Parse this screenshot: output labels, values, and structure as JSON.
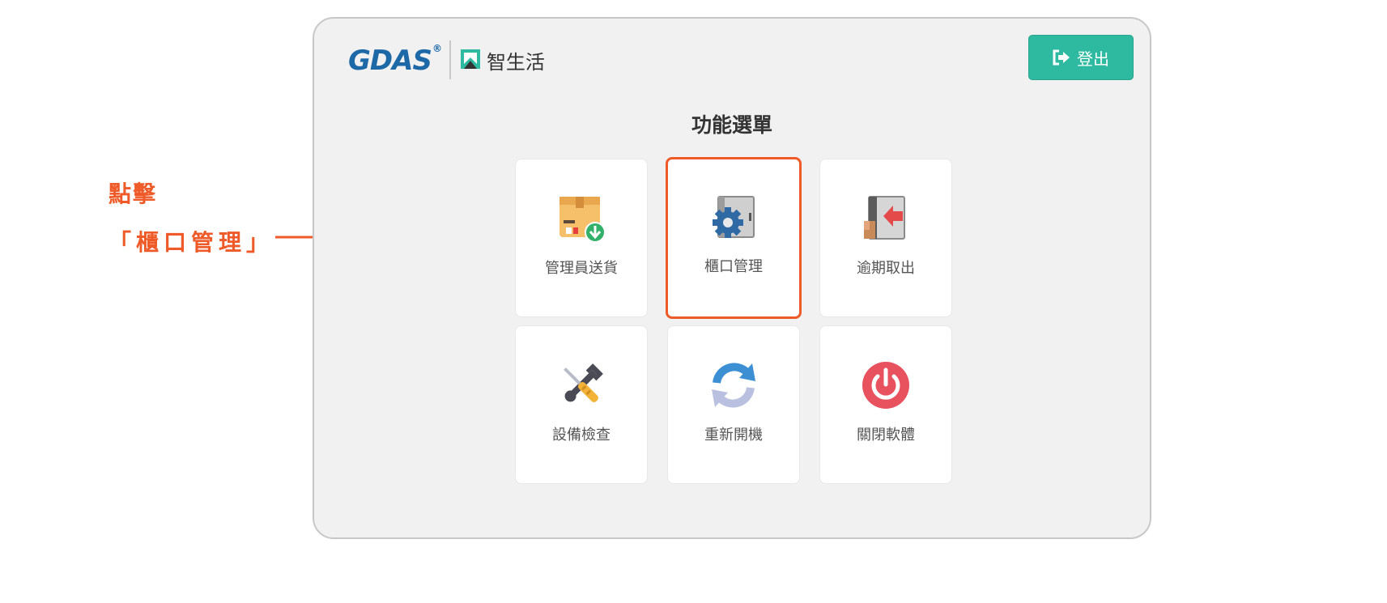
{
  "callout": {
    "line1": "點擊",
    "line2": "「櫃口管理」"
  },
  "header": {
    "logo_brand": "GDAS",
    "logo_trademark": "®",
    "logo_app": "智生活",
    "logout_label": "登出"
  },
  "menu": {
    "title": "功能選單",
    "items": [
      {
        "label": "管理員送貨",
        "icon": "package-download-icon"
      },
      {
        "label": "櫃口管理",
        "icon": "locker-gear-icon"
      },
      {
        "label": "逾期取出",
        "icon": "locker-retrieve-icon"
      },
      {
        "label": "設備檢查",
        "icon": "wrench-screwdriver-icon"
      },
      {
        "label": "重新開機",
        "icon": "restart-icon"
      },
      {
        "label": "關閉軟體",
        "icon": "power-icon"
      }
    ]
  },
  "colors": {
    "accent": "#2ebaa0",
    "highlight": "#ee5a28",
    "brand_blue": "#1d69a8"
  }
}
